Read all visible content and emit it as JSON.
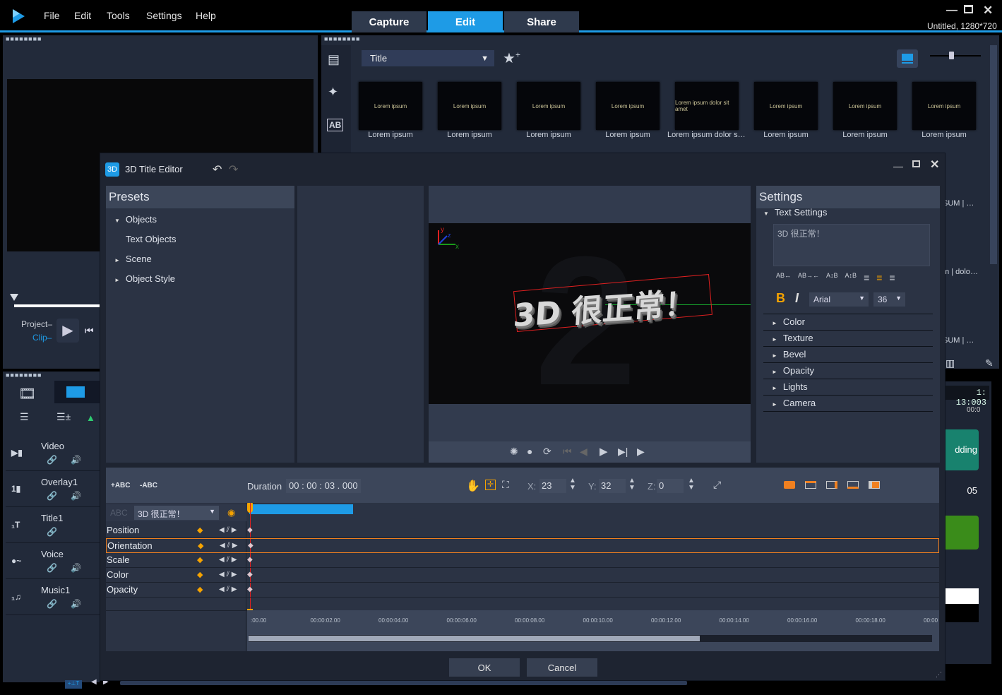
{
  "app": {
    "menu": [
      "File",
      "Edit",
      "Tools",
      "Settings",
      "Help"
    ],
    "mode_tabs": [
      {
        "label": "Capture",
        "active": false
      },
      {
        "label": "Edit",
        "active": true
      },
      {
        "label": "Share",
        "active": false
      }
    ],
    "project_info": "Untitled, 1280*720",
    "accent": "#1e9be6"
  },
  "library": {
    "category_select": "Title",
    "thumbs": [
      {
        "label": "Lorem ipsum",
        "preview": "Lorem ipsum"
      },
      {
        "label": "Lorem ipsum",
        "preview": "Lorem ipsum"
      },
      {
        "label": "Lorem ipsum",
        "preview": "Lorem ipsum"
      },
      {
        "label": "Lorem ipsum",
        "preview": "Lorem ipsum"
      },
      {
        "label": "Lorem ipsum dolor sit...",
        "preview": "Lorem ipsum dolor sit amet"
      },
      {
        "label": "Lorem ipsum",
        "preview": "Lorem ipsum"
      },
      {
        "label": "Lorem ipsum",
        "preview": "Lorem ipsum"
      },
      {
        "label": "Lorem ipsum",
        "preview": "Lorem ipsum"
      }
    ],
    "right_col_labels": [
      "SUM | DO...",
      "m |  dolor ...",
      "SUM | DO..."
    ]
  },
  "player": {
    "project_label": "Project",
    "clip_label": "Clip"
  },
  "timeline_tracks": [
    {
      "name": "Video"
    },
    {
      "name": "Overlay1"
    },
    {
      "name": "Title1"
    },
    {
      "name": "Voice"
    },
    {
      "name": "Music1"
    }
  ],
  "right_timeline": {
    "timecode": "1: 13:003",
    "ruler": "00:0",
    "clip_label": "dding 05"
  },
  "dialog": {
    "title": "3D Title Editor",
    "icon_label": "3D",
    "presets": {
      "heading": "Presets",
      "items": [
        {
          "label": "Objects",
          "expanded": true,
          "indent": 0
        },
        {
          "label": "Text Objects",
          "indent": 1
        },
        {
          "label": "Scene",
          "expanded": false,
          "indent": 0
        },
        {
          "label": "Object Style",
          "expanded": false,
          "indent": 0
        }
      ]
    },
    "preview_text": "3D 很正常！",
    "axes": {
      "x": "x",
      "y": "y",
      "z": "z"
    },
    "settings": {
      "heading": "Settings",
      "text_settings_label": "Text Settings",
      "text_value": "3D 很正常！",
      "font": "Arial",
      "size": "36",
      "bold_active": true,
      "align_active": "center",
      "sections": [
        "Color",
        "Texture",
        "Bevel",
        "Opacity",
        "Lights",
        "Camera"
      ]
    },
    "toolbar": {
      "add_text": "+ABC",
      "remove_text": "-ABC",
      "duration_label": "Duration",
      "duration_value": "00 : 00 : 03 . 000",
      "x_label": "X:",
      "x_value": "23",
      "y_label": "Y:",
      "y_value": "32",
      "z_label": "Z:",
      "z_value": "0"
    },
    "object_select": "3D 很正常！",
    "object_prefix": "ABC",
    "properties": [
      "Position",
      "Orientation",
      "Scale",
      "Color",
      "Opacity"
    ],
    "selected_property": "Orientation",
    "ruler_ticks": [
      ":00.00",
      "00:00:02.00",
      "00:00:04.00",
      "00:00:06.00",
      "00:00:08.00",
      "00:00:10.00",
      "00:00:12.00",
      "00:00:14.00",
      "00:00:16.00",
      "00:00:18.00",
      "00:00"
    ],
    "scroll_fraction": 0.66,
    "ok_label": "OK",
    "cancel_label": "Cancel"
  }
}
